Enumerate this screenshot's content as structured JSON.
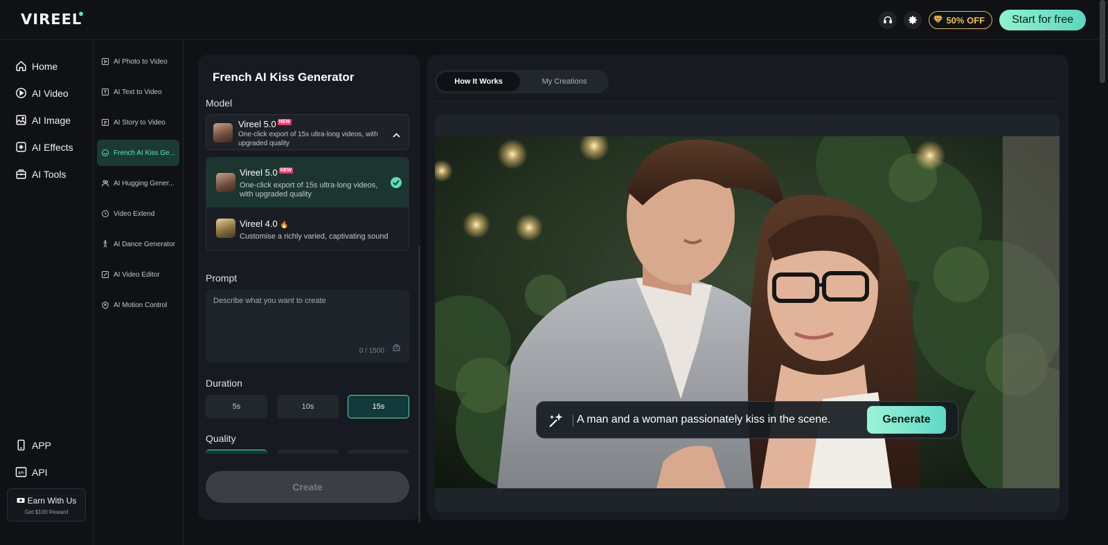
{
  "brand": {
    "logo": "VIREEL"
  },
  "topbar": {
    "promo": "50% OFF",
    "start_label": "Start for free"
  },
  "nav": {
    "items": [
      {
        "label": "Home",
        "icon": "home-icon"
      },
      {
        "label": "AI Video",
        "icon": "play-icon"
      },
      {
        "label": "AI Image",
        "icon": "image-icon"
      },
      {
        "label": "AI Effects",
        "icon": "effects-icon"
      },
      {
        "label": "AI Tools",
        "icon": "toolbox-icon"
      }
    ],
    "bottom_items": [
      {
        "label": "APP",
        "icon": "phone-icon"
      },
      {
        "label": "API",
        "icon": "api-icon"
      }
    ],
    "earn": {
      "title": "Earn With Us",
      "subtitle": "Get $100 Reward"
    }
  },
  "subnav": {
    "items": [
      {
        "label": "AI Photo to Video"
      },
      {
        "label": "AI Text to Video"
      },
      {
        "label": "AI Story to Video"
      },
      {
        "label": "French AI Kiss Ge..."
      },
      {
        "label": "AI Hugging Gener..."
      },
      {
        "label": "Video Extend"
      },
      {
        "label": "AI Dance Generator"
      },
      {
        "label": "AI Video Editor"
      },
      {
        "label": "AI Motion Control"
      }
    ],
    "active": "French AI Kiss Ge..."
  },
  "form": {
    "title": "French AI Kiss Generator",
    "model_label": "Model",
    "selected_model": {
      "name": "Vireel 5.0",
      "badge": "NEW",
      "desc": "One-click export of 15s ultra-long videos, with upgraded quality"
    },
    "options": [
      {
        "name": "Vireel 5.0",
        "badge": "NEW",
        "desc": "One-click export of 15s ultra-long videos, with upgraded quality",
        "selected": true
      },
      {
        "name": "Vireel 4.0",
        "badge": "🔥",
        "desc": "Customise a richly varied, captivating sound",
        "selected": false
      }
    ],
    "prompt_label": "Prompt",
    "prompt_placeholder": "Describe what you want to create",
    "prompt_value": "",
    "counter": "0 / 1500",
    "duration_label": "Duration",
    "durations": [
      "5s",
      "10s",
      "15s"
    ],
    "selected_duration": "15s",
    "quality_label": "Quality",
    "create_label": "Create"
  },
  "preview": {
    "tabs": [
      "How It Works",
      "My Creations"
    ],
    "active_tab": "How It Works",
    "example_prompt": "A man and a woman passionately kiss in the scene.",
    "generate_label": "Generate"
  },
  "colors": {
    "accent": "#5fdcb7",
    "promo": "#f2c14e",
    "bg": "#0f1115",
    "panel": "#171a20"
  }
}
